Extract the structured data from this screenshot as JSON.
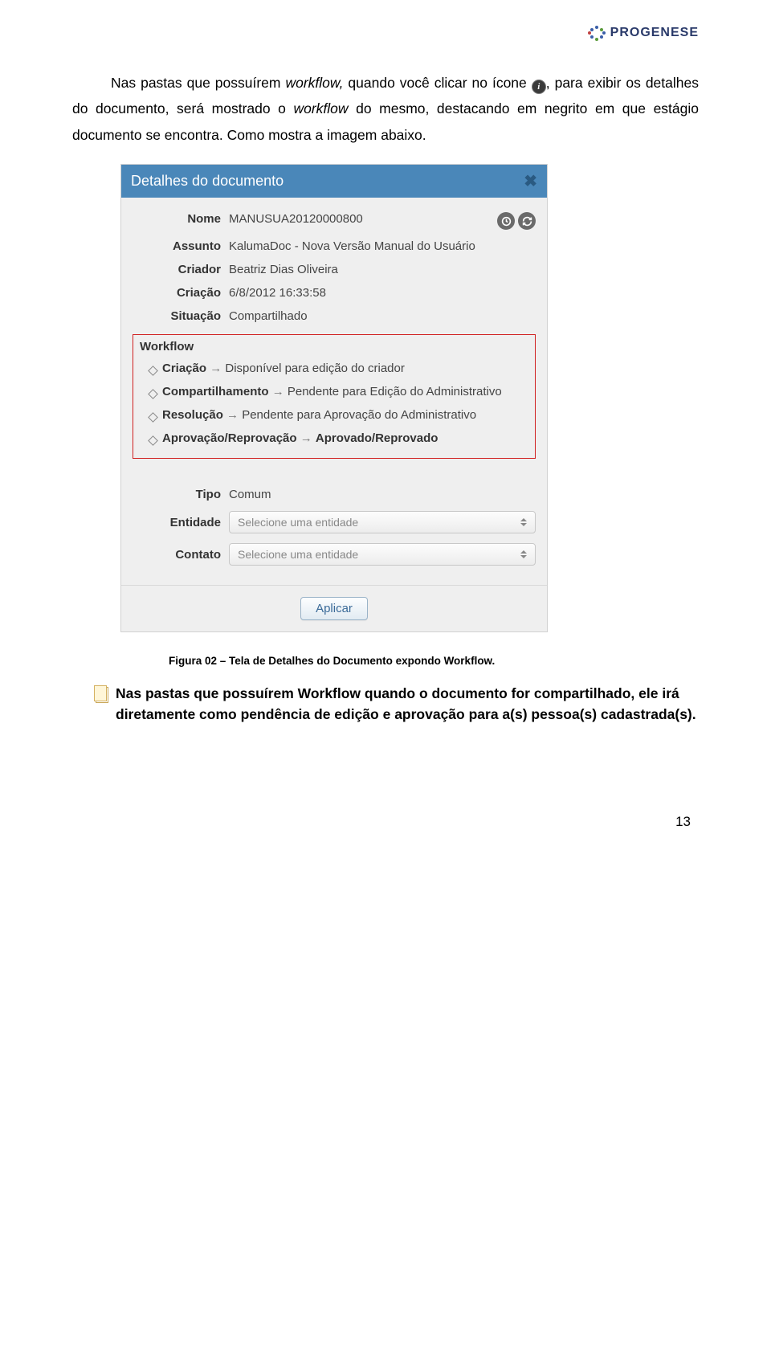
{
  "logo_text": "PROGENESE",
  "para1a": "Nas pastas que possuírem ",
  "para1_wf": "workflow,",
  "para1b": " quando você clicar no ícone ",
  "para2a": ", para exibir os detalhes do documento, será mostrado o ",
  "para2_wf": "workflow",
  "para2b": " do mesmo, destacando em negrito em que estágio documento se encontra. Como mostra a imagem abaixo.",
  "dialog": {
    "title": "Detalhes do documento",
    "labels": {
      "nome": "Nome",
      "assunto": "Assunto",
      "criador": "Criador",
      "criacao": "Criação",
      "situacao": "Situação",
      "tipo": "Tipo",
      "entidade": "Entidade",
      "contato": "Contato"
    },
    "values": {
      "nome": "MANUSUA20120000800",
      "assunto": "KalumaDoc - Nova Versão Manual do Usuário",
      "criador": "Beatriz Dias Oliveira",
      "criacao": "6/8/2012 16:33:58",
      "situacao": "Compartilhado",
      "tipo": "Comum"
    },
    "workflow_title": "Workflow",
    "wf": [
      {
        "stage": "Criação",
        "status": "Disponível para edição do criador"
      },
      {
        "stage": "Compartilhamento",
        "status": "Pendente para Edição do Administrativo"
      },
      {
        "stage": "Resolução",
        "status": "Pendente para Aprovação do Administrativo"
      },
      {
        "stage": "Aprovação/Reprovação",
        "status": "Aprovado/Reprovado",
        "bold_status": true
      }
    ],
    "select_placeholder": "Selecione uma entidade",
    "apply": "Aplicar"
  },
  "caption": "Figura 02 – Tela de Detalhes do Documento expondo Workflow.",
  "note": "Nas pastas que possuírem Workflow quando o documento for compartilhado, ele irá diretamente como pendência de edição e aprovação para a(s) pessoa(s) cadastrada(s).",
  "page_number": "13"
}
